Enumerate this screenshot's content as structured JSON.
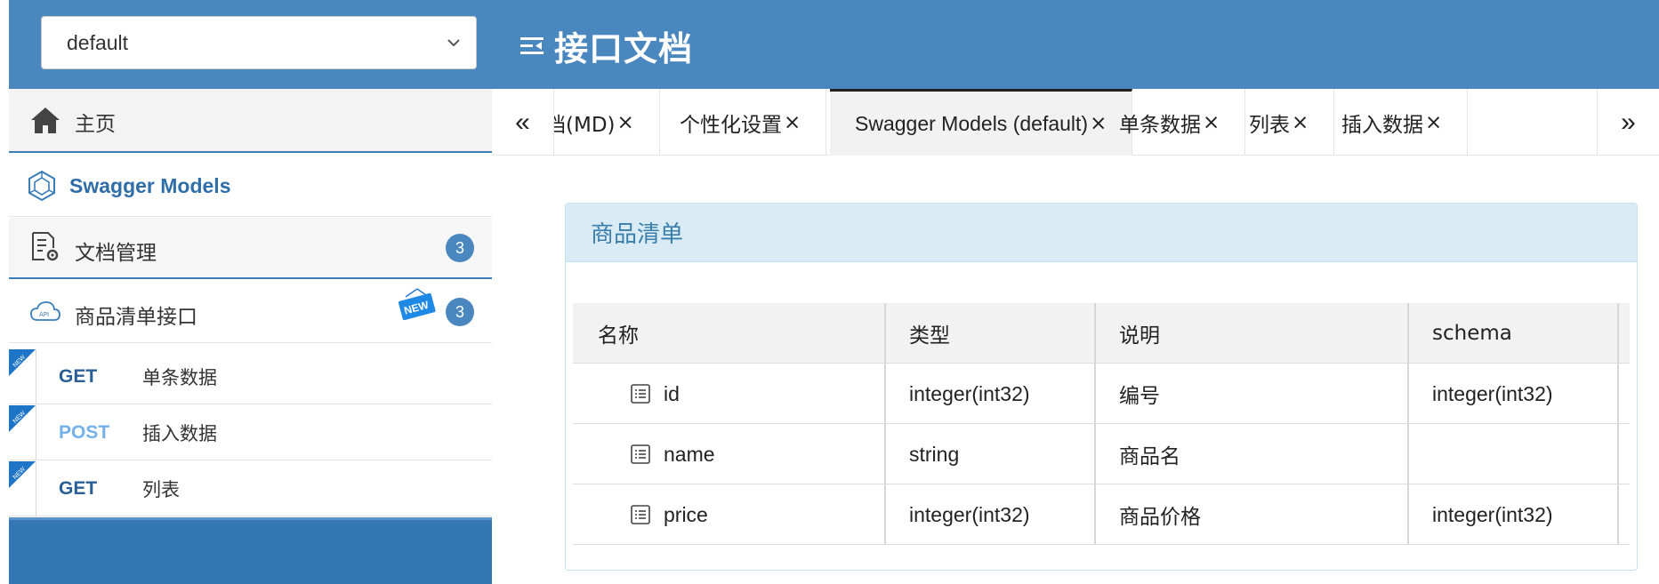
{
  "header": {
    "group_select": {
      "value": "default"
    },
    "title": "接口文档"
  },
  "sidebar": {
    "home": {
      "label": "主页",
      "icon": "home-icon"
    },
    "models": {
      "label": "Swagger Models",
      "icon": "models-icon"
    },
    "docs": {
      "label": "文档管理",
      "icon": "doc-settings-icon",
      "badge": "3"
    },
    "api_group": {
      "label": "商品清单接口",
      "icon": "cloud-api-icon",
      "badge": "3",
      "new_label": "NEW"
    },
    "operations": [
      {
        "method": "GET",
        "name": "单条数据",
        "flag": "NEW"
      },
      {
        "method": "POST",
        "name": "插入数据",
        "flag": "NEW"
      },
      {
        "method": "GET",
        "name": "列表",
        "flag": "NEW"
      }
    ]
  },
  "tabs": {
    "prev": "«",
    "next": "»",
    "items": [
      {
        "label": "档(MD)",
        "close": "×"
      },
      {
        "label": "个性化设置",
        "close": "×"
      },
      {
        "label": "Swagger Models (default)",
        "close": "×",
        "active": true
      },
      {
        "label": "单条数据",
        "close": "×"
      },
      {
        "label": "列表",
        "close": "×"
      },
      {
        "label": "插入数据",
        "close": "×"
      }
    ]
  },
  "panel": {
    "title": "商品清单",
    "columns": [
      "名称",
      "类型",
      "说明",
      "schema"
    ],
    "rows": [
      {
        "name": "id",
        "type": "integer(int32)",
        "desc": "编号",
        "schema": "integer(int32)"
      },
      {
        "name": "name",
        "type": "string",
        "desc": "商品名",
        "schema": ""
      },
      {
        "name": "price",
        "type": "integer(int32)",
        "desc": "商品价格",
        "schema": "integer(int32)"
      }
    ]
  },
  "colors": {
    "header_bg": "#4a87bf",
    "accent": "#3a7db8",
    "get_method": "#2a5f95",
    "post_method": "#74b1ea",
    "panel_head_bg": "#d9ecf5"
  }
}
